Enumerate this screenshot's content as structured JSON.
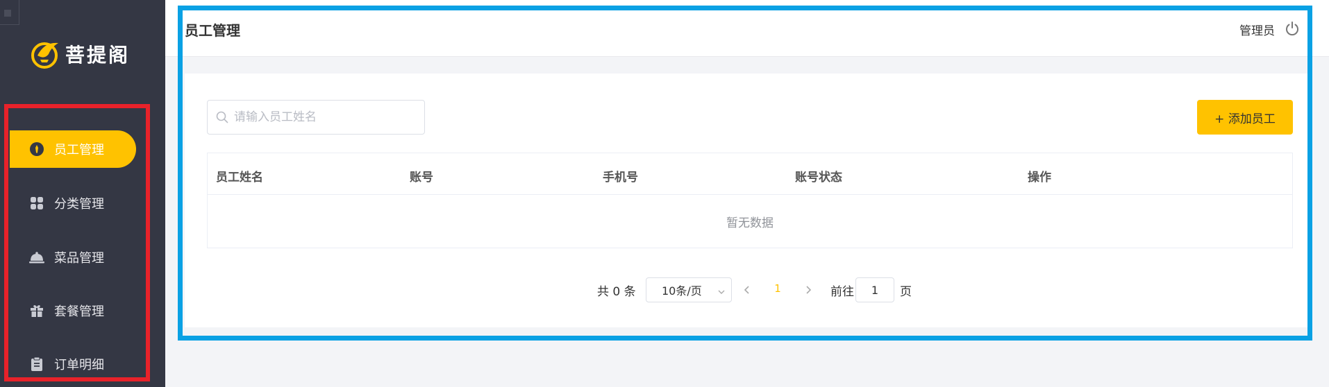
{
  "app": {
    "logo_text": "菩提阁"
  },
  "sidebar": {
    "items": [
      {
        "label": "员工管理",
        "icon": "employee-icon",
        "active": true
      },
      {
        "label": "分类管理",
        "icon": "grid-icon",
        "active": false
      },
      {
        "label": "菜品管理",
        "icon": "dish-cloche-icon",
        "active": false
      },
      {
        "label": "套餐管理",
        "icon": "gift-icon",
        "active": false
      },
      {
        "label": "订单明细",
        "icon": "clipboard-icon",
        "active": false
      }
    ]
  },
  "header": {
    "title": "员工管理",
    "user": "管理员",
    "logout_icon": "power-icon"
  },
  "toolbar": {
    "search_placeholder": "请输入员工姓名",
    "search_value": "",
    "add_label": "+ 添加员工"
  },
  "table": {
    "columns": [
      "员工姓名",
      "账号",
      "手机号",
      "账号状态",
      "操作"
    ],
    "rows": [],
    "empty_text": "暂无数据"
  },
  "pagination": {
    "total_text": "共 0 条",
    "page_size": "10条/页",
    "current_page": "1",
    "goto_label": "前往",
    "goto_value": "1",
    "page_suffix": "页"
  },
  "colors": {
    "accent": "#ffc200",
    "sidebar_bg": "#343744",
    "highlight_red": "#e8222a",
    "highlight_blue": "#0aa1e4"
  }
}
